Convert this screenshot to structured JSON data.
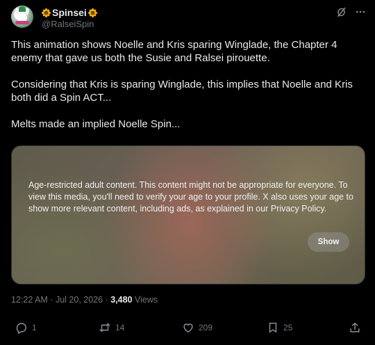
{
  "author": {
    "display_name": "Spinsei",
    "handle": "@RalseiSpin",
    "name_emoji": "sunflower-icon"
  },
  "tweet": {
    "paragraphs": [
      "This animation shows Noelle and Kris sparing Winglade, the Chapter 4 enemy that gave us both the Susie and Ralsei pirouette.",
      "Considering that Kris is sparing Winglade, this implies that Noelle and Kris both did a Spin ACT...",
      "Melts made an implied Noelle Spin..."
    ]
  },
  "media": {
    "warning": "Age-restricted adult content. This content might not be appropriate for everyone. To view this media, you'll need to verify your age to your profile. X also uses your age to show more relevant content, including ads, as explained in our Privacy Policy.",
    "show_label": "Show"
  },
  "meta": {
    "time": "12:22 AM",
    "separator": "·",
    "date": "Jul 20, 2026",
    "views_count": "3,480",
    "views_label": "Views"
  },
  "actions": {
    "replies": "1",
    "reposts": "14",
    "likes": "209",
    "bookmarks": "25"
  },
  "icons": {
    "top": [
      "grok-icon",
      "more-icon"
    ],
    "actions": [
      "reply-icon",
      "repost-icon",
      "like-icon",
      "bookmark-icon",
      "share-icon"
    ]
  },
  "colors": {
    "background": "#000000",
    "text": "#e7e9ea",
    "secondary": "#71767b"
  }
}
